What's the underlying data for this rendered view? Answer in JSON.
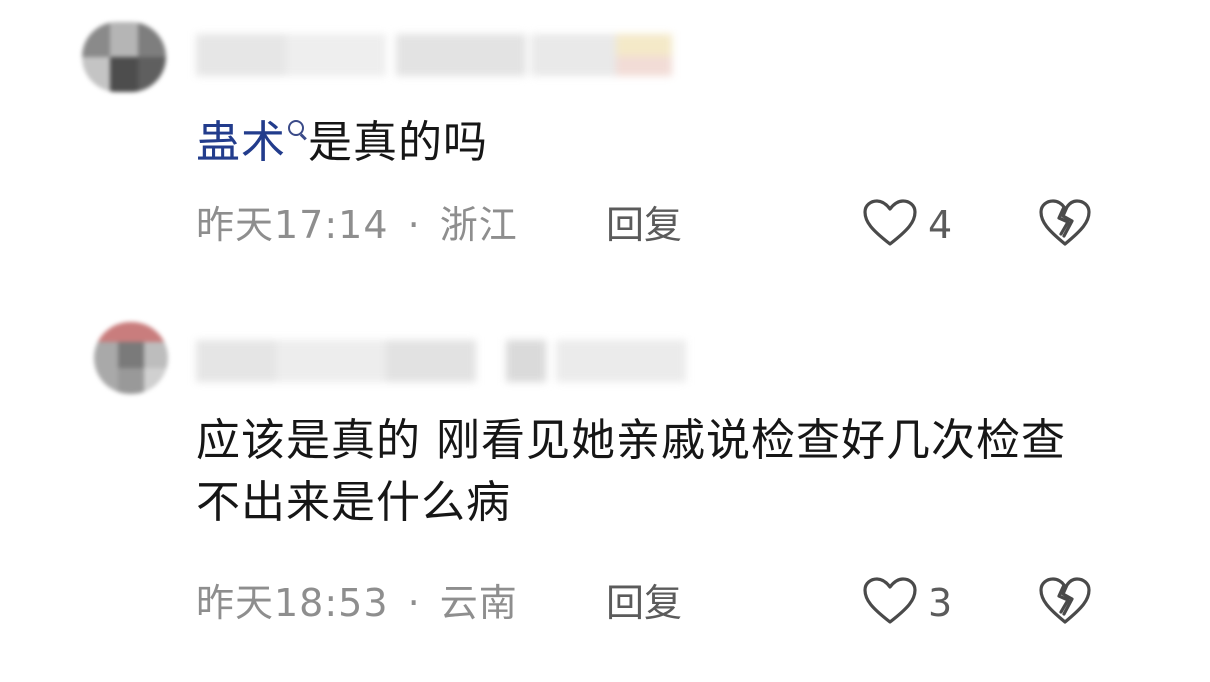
{
  "comments": [
    {
      "text_link": "蛊术",
      "text": "是真的吗",
      "time": "昨天17:14",
      "separator": "·",
      "location": "浙江",
      "reply_label": "回复",
      "like_count": "4",
      "icons": {
        "like": "heart-outline-icon",
        "dislike": "broken-heart-icon",
        "search": "search-icon"
      }
    },
    {
      "text": "应该是真的 刚看见她亲戚说检查好几次检查不出来是什么病",
      "time": "昨天18:53",
      "separator": "·",
      "location": "云南",
      "reply_label": "回复",
      "like_count": "3",
      "icons": {
        "like": "heart-outline-icon",
        "dislike": "broken-heart-icon"
      }
    }
  ],
  "colors": {
    "link": "#223c8c",
    "meta": "#8e8e8e",
    "icon": "#4a4a4a"
  }
}
